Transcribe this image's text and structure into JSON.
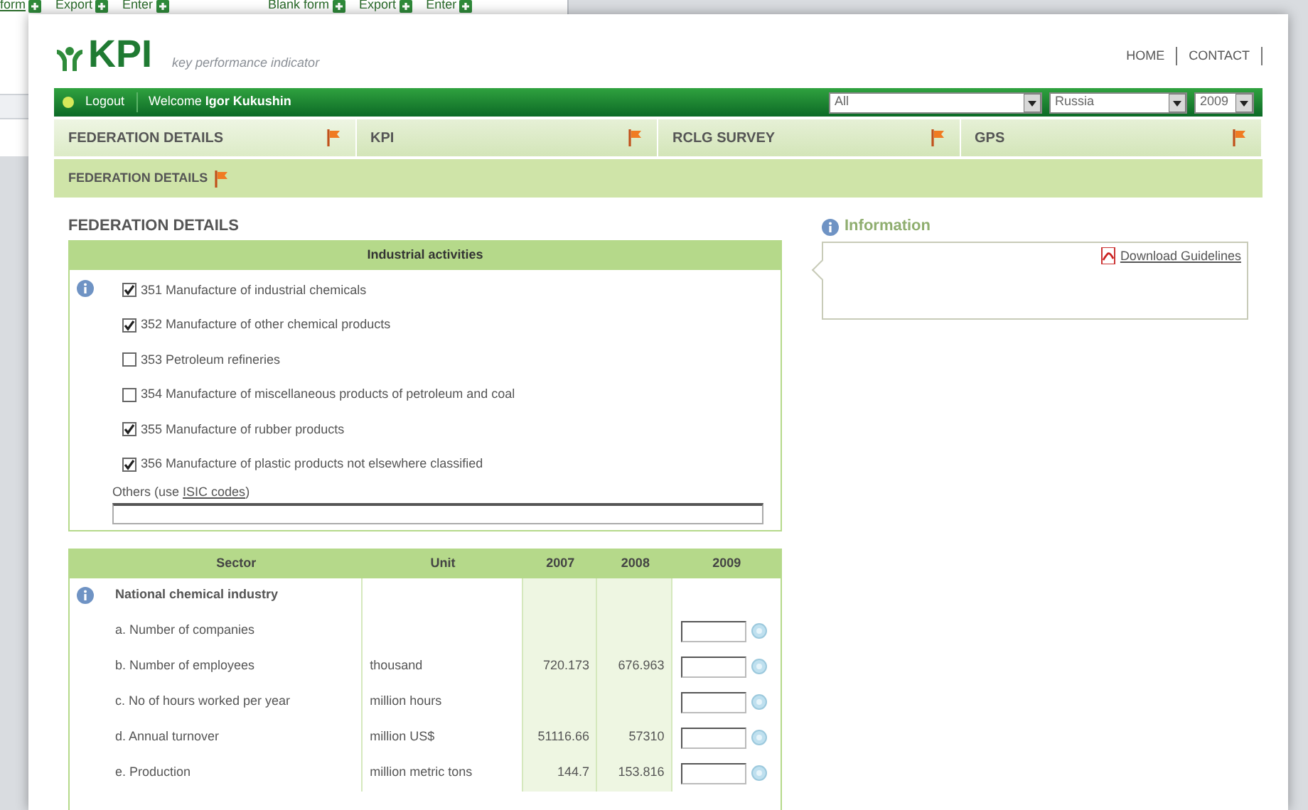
{
  "background_window": {
    "actions": [
      {
        "label": "form"
      },
      {
        "label": "Export"
      },
      {
        "label": "Enter"
      },
      {
        "label": "Blank form"
      },
      {
        "label": "Export"
      },
      {
        "label": "Enter"
      }
    ]
  },
  "header": {
    "logo": "KPI",
    "tagline": "key performance indicator",
    "links": [
      "HOME",
      "CONTACT"
    ]
  },
  "user_bar": {
    "logout": "Logout",
    "welcome": "Welcome",
    "user": "Igor Kukushin",
    "filters": [
      {
        "value": "All"
      },
      {
        "value": "Russia"
      },
      {
        "value": "2009"
      }
    ]
  },
  "tabs": [
    {
      "label": "FEDERATION DETAILS",
      "selected": true
    },
    {
      "label": "KPI",
      "selected": false
    },
    {
      "label": "RCLG SURVEY",
      "selected": false
    },
    {
      "label": "GPS",
      "selected": false
    }
  ],
  "subnav": {
    "label": "FEDERATION DETAILS"
  },
  "section_title": "FEDERATION DETAILS",
  "activities": {
    "title": "Industrial activities",
    "items": [
      {
        "label": "351 Manufacture of industrial chemicals",
        "checked": true
      },
      {
        "label": "352 Manufacture of other chemical products",
        "checked": true
      },
      {
        "label": "353 Petroleum refineries",
        "checked": false
      },
      {
        "label": "354 Manufacture of miscellaneous products of petroleum and coal",
        "checked": false
      },
      {
        "label": "355 Manufacture of rubber products",
        "checked": true
      },
      {
        "label": "356 Manufacture of plastic products not elsewhere classified",
        "checked": true
      }
    ],
    "others_prefix": "Others (use",
    "others_link": "ISIC codes",
    "others_suffix": ")"
  },
  "table": {
    "columns": [
      "Sector",
      "Unit",
      "2007",
      "2008",
      "2009"
    ],
    "group": "National chemical industry",
    "rows": [
      {
        "sector": "a. Number of companies"
      },
      {
        "sector": "b. Number of employees",
        "unit": "thousand",
        "y2007": "720.173",
        "y2008": "676.963"
      },
      {
        "sector": "c. No of hours worked per year",
        "unit": "million hours"
      },
      {
        "sector": "d. Annual turnover",
        "unit": "million US$",
        "y2007": "51116.66",
        "y2008": "57310"
      },
      {
        "sector": "e. Production",
        "unit": "million metric tons",
        "y2007": "144.7",
        "y2008": "153.816"
      }
    ]
  },
  "information": {
    "title": "Information",
    "download": "Download Guidelines"
  }
}
